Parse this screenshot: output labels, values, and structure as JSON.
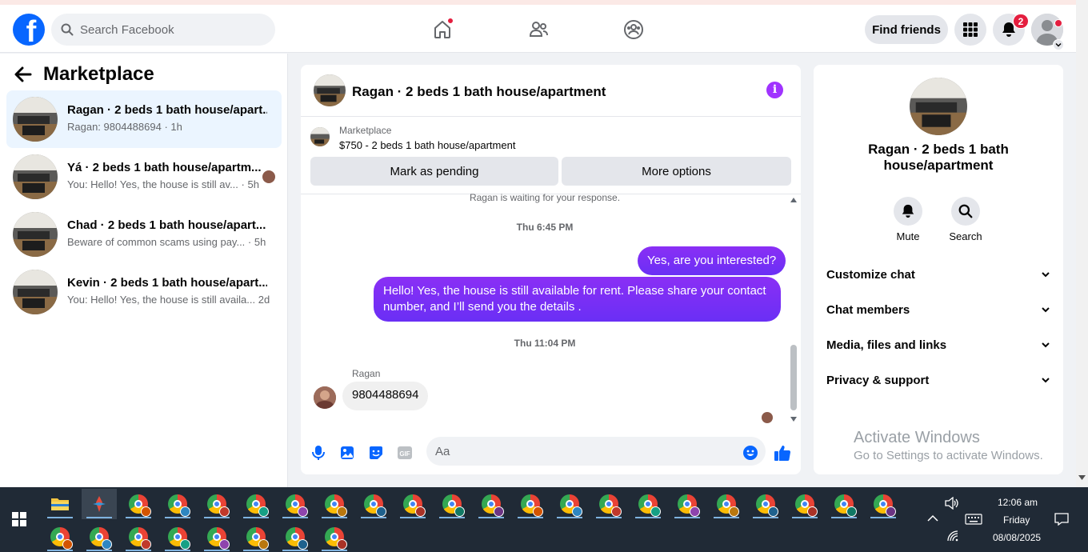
{
  "topbar": {
    "search_placeholder": "Search Facebook",
    "find_friends_label": "Find friends",
    "notification_count": "2"
  },
  "left": {
    "title": "Marketplace",
    "conversations": [
      {
        "title": "Ragan · 2 beds 1 bath house/apart...",
        "preview": "Ragan: 9804488694 · 1h"
      },
      {
        "title": "Yá · 2 beds 1 bath house/apartm...",
        "preview": "You: Hello! Yes, the house is still av... · 5h"
      },
      {
        "title": "Chad · 2 beds 1 bath house/apart...",
        "preview": "Beware of common scams using pay... · 5h"
      },
      {
        "title": "Kevin · 2 beds 1 bath house/apart...",
        "preview": "You: Hello! Yes, the house is still availa... 2d"
      }
    ]
  },
  "chat": {
    "header_name": "Ragan · 2 beds 1 bath house/apartment",
    "marketplace_label": "Marketplace",
    "listing": "$750 - 2 beds 1 bath house/apartment",
    "mark_pending_label": "Mark as pending",
    "more_options_label": "More options",
    "waiting_text": "Ragan is waiting for your response.",
    "time1": "Thu 6:45 PM",
    "out_msg1": "Yes, are you interested?",
    "out_msg2": "Hello! Yes, the house is still available for rent. Please share your contact number, and I’ll send you the details .",
    "time2": "Thu 11:04 PM",
    "sender_name": "Ragan",
    "in_msg": "9804488694",
    "composer_placeholder": "Aa"
  },
  "right": {
    "title": "Ragan · 2 beds 1 bath house/apartment",
    "mute_label": "Mute",
    "search_label": "Search",
    "sections": [
      "Customize chat",
      "Chat members",
      "Media, files and links",
      "Privacy & support"
    ]
  },
  "watermark": {
    "line1": "Activate Windows",
    "line2": "Go to Settings to activate Windows."
  },
  "taskbar": {
    "time": "12:06 am",
    "day": "Friday",
    "date": "08/08/2025"
  },
  "colors": {
    "brand": "#0866ff",
    "bubble": "#7b2ff7",
    "badge": "#e41e3f"
  }
}
